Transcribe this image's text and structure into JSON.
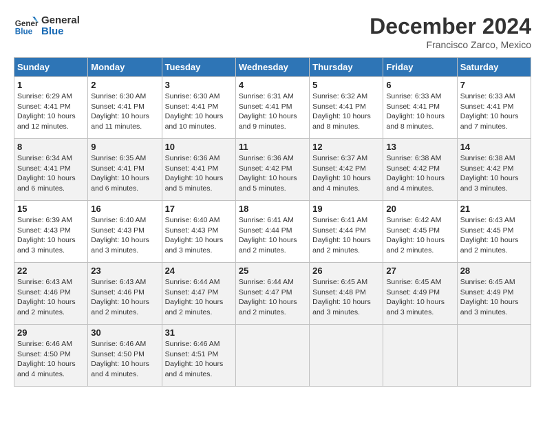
{
  "header": {
    "logo_line1": "General",
    "logo_line2": "Blue",
    "month": "December 2024",
    "location": "Francisco Zarco, Mexico"
  },
  "days_of_week": [
    "Sunday",
    "Monday",
    "Tuesday",
    "Wednesday",
    "Thursday",
    "Friday",
    "Saturday"
  ],
  "weeks": [
    [
      {
        "day": "1",
        "info": "Sunrise: 6:29 AM\nSunset: 4:41 PM\nDaylight: 10 hours\nand 12 minutes."
      },
      {
        "day": "2",
        "info": "Sunrise: 6:30 AM\nSunset: 4:41 PM\nDaylight: 10 hours\nand 11 minutes."
      },
      {
        "day": "3",
        "info": "Sunrise: 6:30 AM\nSunset: 4:41 PM\nDaylight: 10 hours\nand 10 minutes."
      },
      {
        "day": "4",
        "info": "Sunrise: 6:31 AM\nSunset: 4:41 PM\nDaylight: 10 hours\nand 9 minutes."
      },
      {
        "day": "5",
        "info": "Sunrise: 6:32 AM\nSunset: 4:41 PM\nDaylight: 10 hours\nand 8 minutes."
      },
      {
        "day": "6",
        "info": "Sunrise: 6:33 AM\nSunset: 4:41 PM\nDaylight: 10 hours\nand 8 minutes."
      },
      {
        "day": "7",
        "info": "Sunrise: 6:33 AM\nSunset: 4:41 PM\nDaylight: 10 hours\nand 7 minutes."
      }
    ],
    [
      {
        "day": "8",
        "info": "Sunrise: 6:34 AM\nSunset: 4:41 PM\nDaylight: 10 hours\nand 6 minutes."
      },
      {
        "day": "9",
        "info": "Sunrise: 6:35 AM\nSunset: 4:41 PM\nDaylight: 10 hours\nand 6 minutes."
      },
      {
        "day": "10",
        "info": "Sunrise: 6:36 AM\nSunset: 4:41 PM\nDaylight: 10 hours\nand 5 minutes."
      },
      {
        "day": "11",
        "info": "Sunrise: 6:36 AM\nSunset: 4:42 PM\nDaylight: 10 hours\nand 5 minutes."
      },
      {
        "day": "12",
        "info": "Sunrise: 6:37 AM\nSunset: 4:42 PM\nDaylight: 10 hours\nand 4 minutes."
      },
      {
        "day": "13",
        "info": "Sunrise: 6:38 AM\nSunset: 4:42 PM\nDaylight: 10 hours\nand 4 minutes."
      },
      {
        "day": "14",
        "info": "Sunrise: 6:38 AM\nSunset: 4:42 PM\nDaylight: 10 hours\nand 3 minutes."
      }
    ],
    [
      {
        "day": "15",
        "info": "Sunrise: 6:39 AM\nSunset: 4:43 PM\nDaylight: 10 hours\nand 3 minutes."
      },
      {
        "day": "16",
        "info": "Sunrise: 6:40 AM\nSunset: 4:43 PM\nDaylight: 10 hours\nand 3 minutes."
      },
      {
        "day": "17",
        "info": "Sunrise: 6:40 AM\nSunset: 4:43 PM\nDaylight: 10 hours\nand 3 minutes."
      },
      {
        "day": "18",
        "info": "Sunrise: 6:41 AM\nSunset: 4:44 PM\nDaylight: 10 hours\nand 2 minutes."
      },
      {
        "day": "19",
        "info": "Sunrise: 6:41 AM\nSunset: 4:44 PM\nDaylight: 10 hours\nand 2 minutes."
      },
      {
        "day": "20",
        "info": "Sunrise: 6:42 AM\nSunset: 4:45 PM\nDaylight: 10 hours\nand 2 minutes."
      },
      {
        "day": "21",
        "info": "Sunrise: 6:43 AM\nSunset: 4:45 PM\nDaylight: 10 hours\nand 2 minutes."
      }
    ],
    [
      {
        "day": "22",
        "info": "Sunrise: 6:43 AM\nSunset: 4:46 PM\nDaylight: 10 hours\nand 2 minutes."
      },
      {
        "day": "23",
        "info": "Sunrise: 6:43 AM\nSunset: 4:46 PM\nDaylight: 10 hours\nand 2 minutes."
      },
      {
        "day": "24",
        "info": "Sunrise: 6:44 AM\nSunset: 4:47 PM\nDaylight: 10 hours\nand 2 minutes."
      },
      {
        "day": "25",
        "info": "Sunrise: 6:44 AM\nSunset: 4:47 PM\nDaylight: 10 hours\nand 2 minutes."
      },
      {
        "day": "26",
        "info": "Sunrise: 6:45 AM\nSunset: 4:48 PM\nDaylight: 10 hours\nand 3 minutes."
      },
      {
        "day": "27",
        "info": "Sunrise: 6:45 AM\nSunset: 4:49 PM\nDaylight: 10 hours\nand 3 minutes."
      },
      {
        "day": "28",
        "info": "Sunrise: 6:45 AM\nSunset: 4:49 PM\nDaylight: 10 hours\nand 3 minutes."
      }
    ],
    [
      {
        "day": "29",
        "info": "Sunrise: 6:46 AM\nSunset: 4:50 PM\nDaylight: 10 hours\nand 4 minutes."
      },
      {
        "day": "30",
        "info": "Sunrise: 6:46 AM\nSunset: 4:50 PM\nDaylight: 10 hours\nand 4 minutes."
      },
      {
        "day": "31",
        "info": "Sunrise: 6:46 AM\nSunset: 4:51 PM\nDaylight: 10 hours\nand 4 minutes."
      },
      null,
      null,
      null,
      null
    ]
  ]
}
